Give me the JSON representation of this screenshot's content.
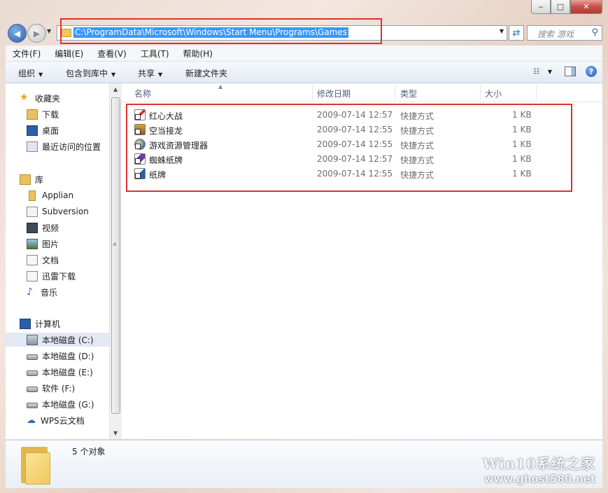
{
  "window": {
    "minimize": "‒",
    "maximize": "□",
    "close": "✕"
  },
  "nav": {
    "address": "C:\\ProgramData\\Microsoft\\Windows\\Start Menu\\Programs\\Games",
    "search_placeholder": "搜索 游戏"
  },
  "menu": [
    "文件(F)",
    "编辑(E)",
    "查看(V)",
    "工具(T)",
    "帮助(H)"
  ],
  "toolbar": {
    "organize": "组织",
    "include": "包含到库中",
    "share": "共享",
    "new_folder": "新建文件夹"
  },
  "sidebar": {
    "favorites": {
      "label": "收藏夹",
      "items": [
        "下载",
        "桌面",
        "最近访问的位置"
      ]
    },
    "libraries": {
      "label": "库",
      "items": [
        "Applian",
        "Subversion",
        "视频",
        "图片",
        "文档",
        "迅雷下载",
        "音乐"
      ]
    },
    "computer": {
      "label": "计算机",
      "items": [
        "本地磁盘 (C:)",
        "本地磁盘 (D:)",
        "本地磁盘 (E:)",
        "软件 (F:)",
        "本地磁盘 (G:)",
        "WPS云文档"
      ],
      "selected": "本地磁盘 (C:)"
    }
  },
  "columns": {
    "name": "名称",
    "date": "修改日期",
    "type": "类型",
    "size": "大小"
  },
  "files": [
    {
      "name": "红心大战",
      "date": "2009-07-14 12:57",
      "type": "快捷方式",
      "size": "1 KB",
      "icon": "hearts-icon"
    },
    {
      "name": "空当接龙",
      "date": "2009-07-14 12:55",
      "type": "快捷方式",
      "size": "1 KB",
      "icon": "freecell-icon"
    },
    {
      "name": "游戏资源管理器",
      "date": "2009-07-14 12:55",
      "type": "快捷方式",
      "size": "1 KB",
      "icon": "games-explorer-icon"
    },
    {
      "name": "蜘蛛纸牌",
      "date": "2009-07-14 12:57",
      "type": "快捷方式",
      "size": "1 KB",
      "icon": "spider-solitaire-icon"
    },
    {
      "name": "纸牌",
      "date": "2009-07-14 12:55",
      "type": "快捷方式",
      "size": "1 KB",
      "icon": "solitaire-icon"
    }
  ],
  "status": {
    "count": "5 个对象"
  },
  "watermark": {
    "line1": "Win10系统之家",
    "line2": "www.ghost580.net"
  },
  "colors": {
    "highlight": "#3399ff",
    "annotation": "#e03030",
    "folder": "#f1c95a"
  }
}
